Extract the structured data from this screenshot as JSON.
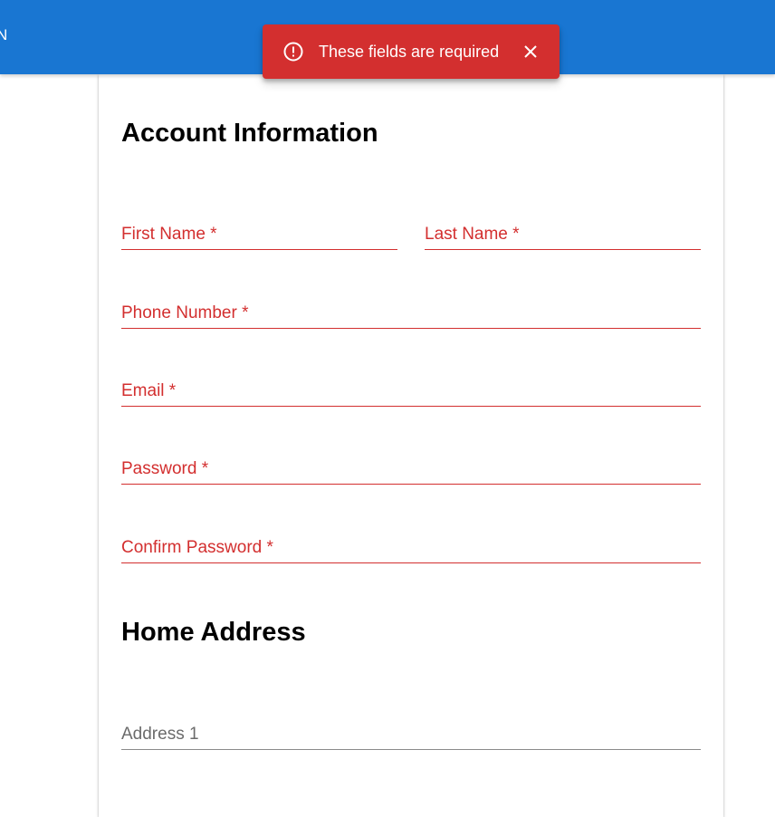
{
  "appbar": {
    "partial_text": "N",
    "color": "#1976d2"
  },
  "snackbar": {
    "message": "These fields are required",
    "icon": "error-outline-icon",
    "close_icon": "close-icon",
    "color": "#d32f2f"
  },
  "sections": {
    "account": {
      "title": "Account Information",
      "fields": {
        "first_name": {
          "label": "First Name *",
          "value": ""
        },
        "last_name": {
          "label": "Last Name *",
          "value": ""
        },
        "phone": {
          "label": "Phone Number *",
          "value": ""
        },
        "email": {
          "label": "Email *",
          "value": ""
        },
        "password": {
          "label": "Password *",
          "value": ""
        },
        "confirm_password": {
          "label": "Confirm Password *",
          "value": ""
        }
      }
    },
    "home_address": {
      "title": "Home Address",
      "fields": {
        "address1": {
          "label": "Address 1",
          "value": ""
        }
      }
    }
  },
  "colors": {
    "error": "#d32f2f",
    "primary": "#1976d2"
  }
}
